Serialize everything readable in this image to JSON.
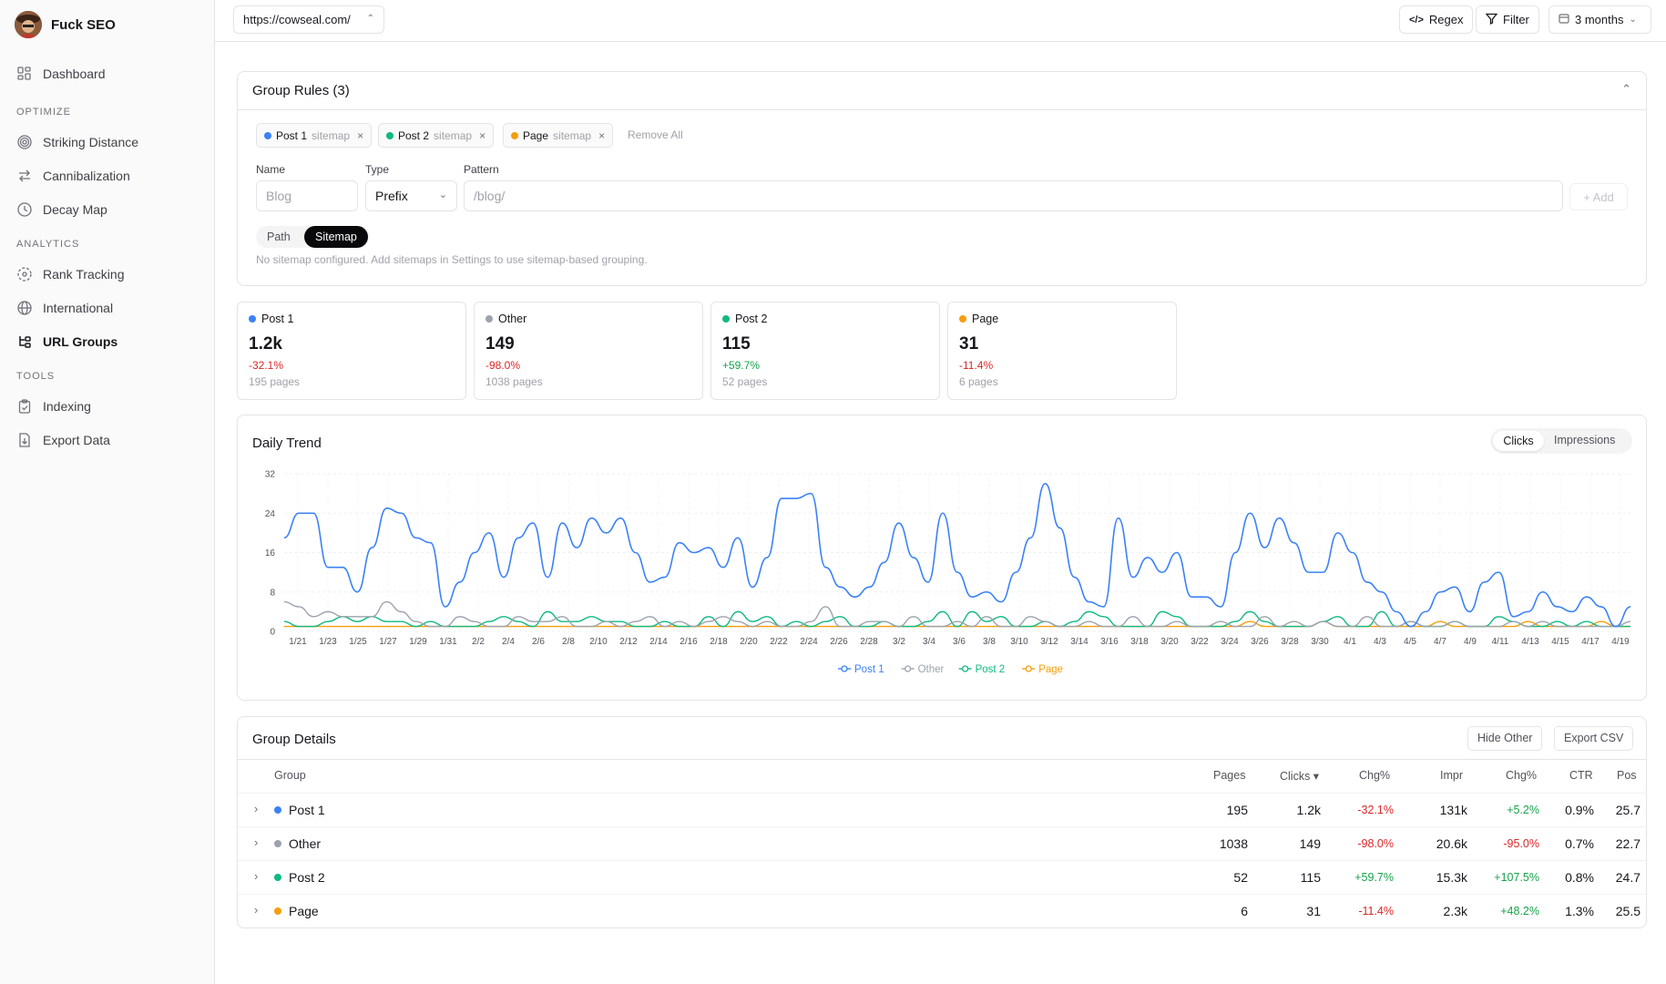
{
  "app": {
    "name": "Fuck SEO"
  },
  "sidebar": {
    "dashboard": "Dashboard",
    "sections": [
      {
        "label": "OPTIMIZE",
        "items": [
          "Striking Distance",
          "Cannibalization",
          "Decay Map"
        ]
      },
      {
        "label": "ANALYTICS",
        "items": [
          "Rank Tracking",
          "International",
          "URL Groups"
        ]
      },
      {
        "label": "TOOLS",
        "items": [
          "Indexing",
          "Export Data"
        ]
      }
    ],
    "active": "URL Groups"
  },
  "topbar": {
    "site": "https://cowseal.com/",
    "regex": "Regex",
    "filter": "Filter",
    "range": "3 months"
  },
  "rules": {
    "title": "Group Rules (3)",
    "chips": [
      {
        "name": "Post 1",
        "source": "sitemap",
        "color": "#3b82f6"
      },
      {
        "name": "Post 2",
        "source": "sitemap",
        "color": "#10b981"
      },
      {
        "name": "Page",
        "source": "sitemap",
        "color": "#f59e0b"
      }
    ],
    "remove_all": "Remove All",
    "name_label": "Name",
    "name_placeholder": "Blog",
    "type_label": "Type",
    "type_value": "Prefix",
    "pattern_label": "Pattern",
    "pattern_placeholder": "/blog/",
    "add": "+ Add",
    "mode_path": "Path",
    "mode_sitemap": "Sitemap",
    "note": "No sitemap configured. Add sitemaps in Settings to use sitemap-based grouping."
  },
  "stats": [
    {
      "name": "Post 1",
      "value": "1.2k",
      "change": "-32.1%",
      "pages": "195 pages",
      "color": "#3b82f6",
      "dir": "neg"
    },
    {
      "name": "Other",
      "value": "149",
      "change": "-98.0%",
      "pages": "1038 pages",
      "color": "#9ca3af",
      "dir": "neg"
    },
    {
      "name": "Post 2",
      "value": "115",
      "change": "+59.7%",
      "pages": "52 pages",
      "color": "#10b981",
      "dir": "pos"
    },
    {
      "name": "Page",
      "value": "31",
      "change": "-11.4%",
      "pages": "6 pages",
      "color": "#f59e0b",
      "dir": "neg"
    }
  ],
  "trend": {
    "title": "Daily Trend",
    "tab_clicks": "Clicks",
    "tab_impressions": "Impressions"
  },
  "chart_data": {
    "type": "line",
    "ylim": [
      0,
      32
    ],
    "yticks": [
      0,
      8,
      16,
      24,
      32
    ],
    "xticks": [
      "1/21",
      "1/23",
      "1/25",
      "1/27",
      "1/29",
      "1/31",
      "2/2",
      "2/4",
      "2/6",
      "2/8",
      "2/10",
      "2/12",
      "2/14",
      "2/16",
      "2/18",
      "2/20",
      "2/22",
      "2/24",
      "2/26",
      "2/28",
      "3/2",
      "3/4",
      "3/6",
      "3/8",
      "3/10",
      "3/12",
      "3/14",
      "3/16",
      "3/18",
      "3/20",
      "3/22",
      "3/24",
      "3/26",
      "3/28",
      "3/30",
      "4/1",
      "4/3",
      "4/5",
      "4/7",
      "4/9",
      "4/11",
      "4/13",
      "4/15",
      "4/17",
      "4/19"
    ],
    "series": [
      {
        "name": "Post 1",
        "color": "#3b82f6",
        "values": [
          19,
          24,
          24,
          13,
          13,
          8,
          17,
          25,
          24,
          19,
          18,
          5,
          10,
          16,
          20,
          11,
          19,
          22,
          11,
          22,
          17,
          23,
          20,
          23,
          16,
          10,
          11,
          18,
          16,
          17,
          13,
          19,
          9,
          15,
          27,
          27,
          28,
          13,
          9,
          7,
          9,
          14,
          22,
          15,
          10,
          24,
          12,
          7,
          8,
          6,
          12,
          19,
          30,
          21,
          11,
          6,
          5,
          23,
          11,
          15,
          12,
          16,
          7,
          7,
          5,
          16,
          24,
          17,
          23,
          18,
          12,
          12,
          20,
          16,
          10,
          8,
          4,
          1,
          4,
          8,
          9,
          4,
          10,
          12,
          3,
          4,
          8,
          5,
          4,
          7,
          5,
          1,
          5
        ]
      },
      {
        "name": "Other",
        "color": "#9ca3af",
        "values": [
          6,
          5,
          3,
          4,
          3,
          3,
          3,
          6,
          4,
          2,
          1,
          1,
          3,
          2,
          1,
          1,
          3,
          2,
          2,
          3,
          1,
          1,
          2,
          1,
          2,
          3,
          1,
          2,
          1,
          2,
          3,
          2,
          1,
          2,
          1,
          1,
          2,
          5,
          1,
          1,
          2,
          2,
          1,
          3,
          1,
          1,
          2,
          1,
          3,
          1,
          1,
          3,
          2,
          1,
          1,
          2,
          1,
          1,
          3,
          1,
          1,
          2,
          1,
          1,
          2,
          1,
          1,
          3,
          1,
          2,
          1,
          2,
          1,
          1,
          3,
          1,
          1,
          2,
          1,
          1,
          2,
          1,
          1,
          1,
          2,
          1,
          2,
          1,
          1,
          1,
          1,
          1,
          2
        ]
      },
      {
        "name": "Post 2",
        "color": "#10b981",
        "values": [
          2,
          1,
          1,
          2,
          3,
          2,
          3,
          2,
          2,
          1,
          2,
          1,
          1,
          1,
          2,
          3,
          2,
          1,
          4,
          2,
          2,
          3,
          2,
          2,
          1,
          1,
          2,
          1,
          1,
          3,
          1,
          4,
          2,
          3,
          1,
          2,
          1,
          2,
          3,
          1,
          1,
          2,
          1,
          1,
          2,
          4,
          1,
          4,
          2,
          3,
          1,
          1,
          2,
          1,
          2,
          4,
          3,
          1,
          1,
          1,
          4,
          3,
          1,
          1,
          1,
          2,
          4,
          2,
          1,
          1,
          1,
          2,
          3,
          1,
          1,
          4,
          1,
          2,
          1,
          1,
          2,
          1,
          1,
          3,
          2,
          1,
          1,
          2,
          1,
          2,
          1,
          1,
          1
        ]
      },
      {
        "name": "Page",
        "color": "#f59e0b",
        "values": [
          1,
          1,
          1,
          1,
          1,
          1,
          1,
          1,
          1,
          1,
          1,
          1,
          1,
          1,
          1,
          1,
          1,
          1,
          1,
          1,
          1,
          1,
          1,
          1,
          1,
          1,
          1,
          1,
          1,
          1,
          1,
          1,
          1,
          1,
          1,
          1,
          1,
          1,
          1,
          1,
          1,
          1,
          1,
          1,
          1,
          1,
          1,
          1,
          1,
          1,
          1,
          1,
          1,
          1,
          1,
          1,
          1,
          1,
          1,
          1,
          1,
          1,
          1,
          1,
          1,
          1,
          2,
          1,
          1,
          1,
          1,
          2,
          1,
          1,
          1,
          1,
          1,
          1,
          1,
          2,
          1,
          1,
          1,
          1,
          1,
          2,
          1,
          1,
          1,
          1,
          2,
          1,
          1
        ]
      }
    ]
  },
  "details": {
    "title": "Group Details",
    "hide_other": "Hide Other",
    "export_csv": "Export CSV",
    "headers": {
      "group": "Group",
      "pages": "Pages",
      "clicks": "Clicks ▾",
      "chg1": "Chg%",
      "impr": "Impr",
      "chg2": "Chg%",
      "ctr": "CTR",
      "pos": "Pos"
    },
    "rows": [
      {
        "name": "Post 1",
        "color": "#3b82f6",
        "pages": "195",
        "clicks": "1.2k",
        "chg1": "-32.1%",
        "chg1_dir": "neg",
        "impr": "131k",
        "chg2": "+5.2%",
        "chg2_dir": "pos",
        "ctr": "0.9%",
        "pos": "25.7"
      },
      {
        "name": "Other",
        "color": "#9ca3af",
        "pages": "1038",
        "clicks": "149",
        "chg1": "-98.0%",
        "chg1_dir": "neg",
        "impr": "20.6k",
        "chg2": "-95.0%",
        "chg2_dir": "neg",
        "ctr": "0.7%",
        "pos": "22.7"
      },
      {
        "name": "Post 2",
        "color": "#10b981",
        "pages": "52",
        "clicks": "115",
        "chg1": "+59.7%",
        "chg1_dir": "pos",
        "impr": "15.3k",
        "chg2": "+107.5%",
        "chg2_dir": "pos",
        "ctr": "0.8%",
        "pos": "24.7"
      },
      {
        "name": "Page",
        "color": "#f59e0b",
        "pages": "6",
        "clicks": "31",
        "chg1": "-11.4%",
        "chg1_dir": "neg",
        "impr": "2.3k",
        "chg2": "+48.2%",
        "chg2_dir": "pos",
        "ctr": "1.3%",
        "pos": "25.5"
      }
    ]
  }
}
